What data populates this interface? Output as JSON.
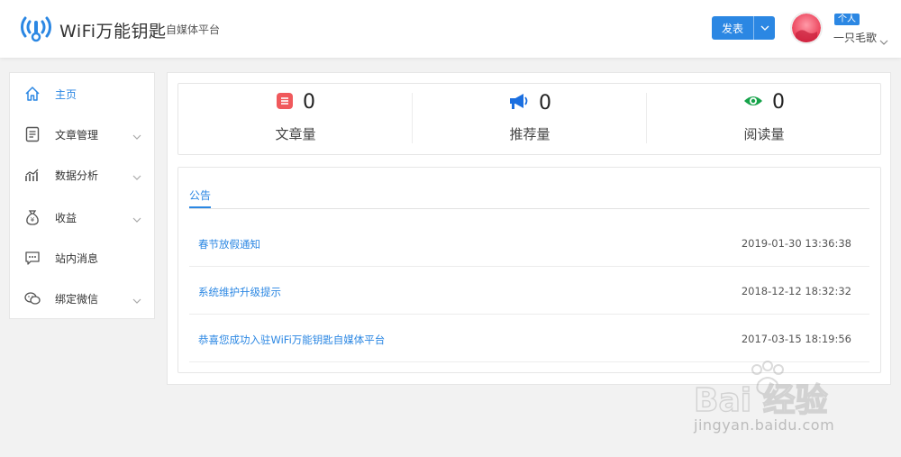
{
  "header": {
    "brand": "WiFi万能钥匙",
    "subbrand": "自媒体平台",
    "publish_label": "发表",
    "badge": "个人",
    "username": "一只毛歌"
  },
  "sidebar": {
    "items": [
      {
        "label": "主页",
        "icon": "home-icon",
        "active": true,
        "expandable": false
      },
      {
        "label": "文章管理",
        "icon": "document-icon",
        "active": false,
        "expandable": true
      },
      {
        "label": "数据分析",
        "icon": "chart-icon",
        "active": false,
        "expandable": true
      },
      {
        "label": "收益",
        "icon": "money-bag-icon",
        "active": false,
        "expandable": true
      },
      {
        "label": "站内消息",
        "icon": "message-icon",
        "active": false,
        "expandable": false
      },
      {
        "label": "绑定微信",
        "icon": "wechat-icon",
        "active": false,
        "expandable": true
      }
    ]
  },
  "stats": [
    {
      "value": "0",
      "label": "文章量",
      "icon": "article-icon",
      "color": "#f0595c"
    },
    {
      "value": "0",
      "label": "推荐量",
      "icon": "megaphone-icon",
      "color": "#1b6fe0"
    },
    {
      "value": "0",
      "label": "阅读量",
      "icon": "eye-icon",
      "color": "#16a34a"
    }
  ],
  "notice": {
    "tab": "公告",
    "items": [
      {
        "title": "春节放假通知",
        "date": "2019-01-30 13:36:38"
      },
      {
        "title": "系统维护升级提示",
        "date": "2018-12-12 18:32:32"
      },
      {
        "title": "恭喜您成功入驻WiFi万能钥匙自媒体平台",
        "date": "2017-03-15 18:19:56"
      }
    ]
  },
  "watermark": {
    "text": "Bai 经验",
    "url": "jingyan.baidu.com"
  },
  "colors": {
    "accent": "#2b87e3",
    "background": "#f2f2f2"
  }
}
